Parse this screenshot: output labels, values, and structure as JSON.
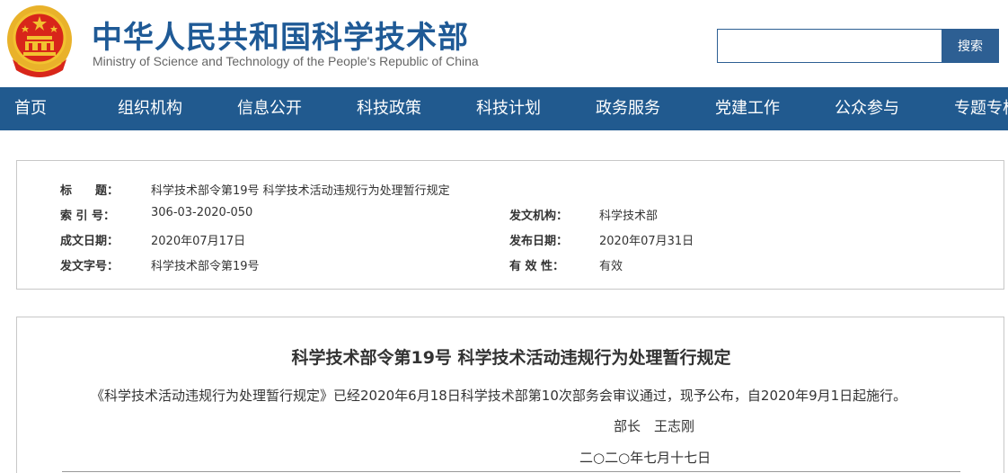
{
  "header": {
    "title": "中华人民共和国科学技术部",
    "subtitle": "Ministry of Science and Technology of the People's Republic of China",
    "emblem_icon": "national-emblem-icon",
    "search_placeholder": "",
    "search_button": "搜索"
  },
  "nav": {
    "items": [
      "首页",
      "组织机构",
      "信息公开",
      "科技政策",
      "科技计划",
      "政务服务",
      "党建工作",
      "公众参与",
      "专题专栏"
    ]
  },
  "info": {
    "title_label": "标　　题：",
    "title_value": "科学技术部令第19号 科学技术活动违规行为处理暂行规定",
    "index_label": "索 引 号：",
    "index_value": "306-03-2020-050",
    "issuer_label": "发文机构：",
    "issuer_value": "科学技术部",
    "written_label": "成文日期：",
    "written_value": "2020年07月17日",
    "published_label": "发布日期：",
    "published_value": "2020年07月31日",
    "docno_label": "发文字号：",
    "docno_value": "科学技术部令第19号",
    "validity_label": "有 效 性：",
    "validity_value": "有效"
  },
  "article": {
    "title": "科学技术部令第19号 科学技术活动违规行为处理暂行规定",
    "paragraph": "《科学技术活动违规行为处理暂行规定》已经2020年6月18日科学技术部第10次部务会审议通过，现予公布，自2020年9月1日起施行。",
    "signer": "部长　王志刚",
    "date": "二○二○年七月十七日"
  },
  "colors": {
    "brand_blue": "#1f5a96",
    "nav_blue": "#215a8f",
    "emblem_red": "#d8261a",
    "emblem_gold": "#f2c230"
  }
}
